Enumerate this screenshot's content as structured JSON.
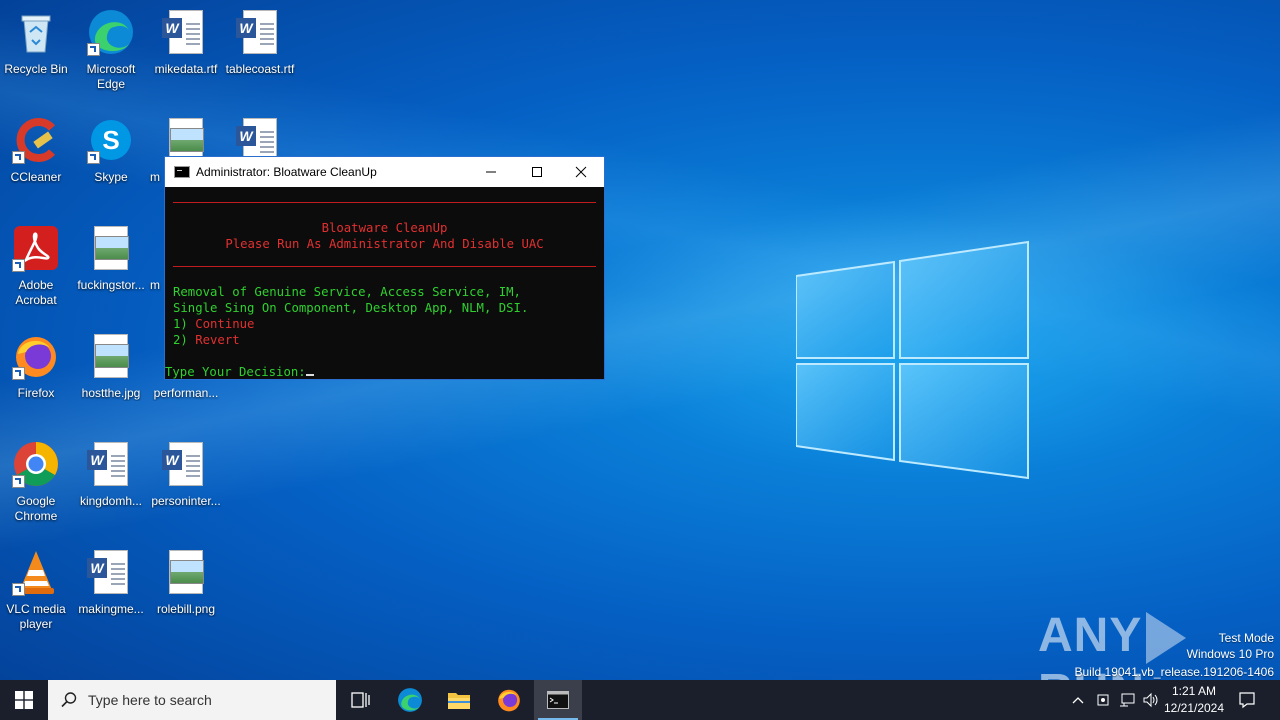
{
  "desktop": {
    "icons": [
      {
        "label": "Recycle Bin",
        "icon": "recycle-bin-icon"
      },
      {
        "label": "Microsoft Edge",
        "icon": "edge-icon"
      },
      {
        "label": "mikedata.rtf",
        "icon": "word-document-icon"
      },
      {
        "label": "tablecoast.rtf",
        "icon": "word-document-icon"
      },
      {
        "label": "CCleaner",
        "icon": "ccleaner-icon"
      },
      {
        "label": "Skype",
        "icon": "skype-icon"
      },
      {
        "label": "m",
        "icon": "image-file-icon"
      },
      {
        "label": "",
        "icon": "word-document-icon"
      },
      {
        "label": "Adobe Acrobat",
        "icon": "acrobat-icon"
      },
      {
        "label": "fuckingstor...",
        "icon": "image-file-icon"
      },
      {
        "label": "m",
        "icon": "image-file-icon"
      },
      {
        "label": "Firefox",
        "icon": "firefox-icon"
      },
      {
        "label": "hostthe.jpg",
        "icon": "image-file-icon"
      },
      {
        "label": "performan...",
        "icon": "image-file-icon"
      },
      {
        "label": "Google Chrome",
        "icon": "chrome-icon"
      },
      {
        "label": "kingdomh...",
        "icon": "word-document-icon"
      },
      {
        "label": "personinter...",
        "icon": "word-document-icon"
      },
      {
        "label": "VLC media player",
        "icon": "vlc-icon"
      },
      {
        "label": "makingme...",
        "icon": "word-document-icon"
      },
      {
        "label": "rolebill.png",
        "icon": "image-file-icon"
      }
    ]
  },
  "console": {
    "title": "Administrator:  Bloatware CleanUp",
    "heading": "Bloatware CleanUp",
    "subheading": "Please Run As Administrator And Disable UAC",
    "desc_line1": "Removal of Genuine Service, Access Service, IM,",
    "desc_line2": "Single Sing On Component, Desktop App, NLM, DSI.",
    "opt1_num": "1)",
    "opt1_text": "Continue",
    "opt2_num": "2)",
    "opt2_text": "Revert",
    "prompt": "Type Your Decision:",
    "colors": {
      "heading": "#e23030",
      "text": "#2fd12f",
      "rule": "#c21c1c"
    }
  },
  "watermark": {
    "brand_left": "ANY",
    "brand_right": "RUN",
    "line1": "Test Mode",
    "line2": "Windows 10 Pro",
    "line3": "Build 19041.vb_release.191206-1406"
  },
  "taskbar": {
    "search_placeholder": "Type here to search",
    "time": "1:21 AM",
    "date": "12/21/2024"
  }
}
